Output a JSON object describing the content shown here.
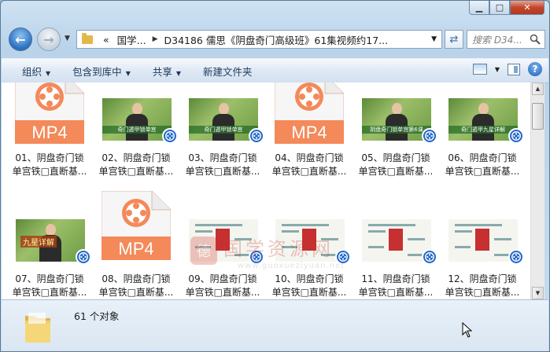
{
  "window": {
    "caption_minimize": "▁",
    "caption_maximize": "□",
    "caption_close": "✕"
  },
  "navigation": {
    "back_icon": "back-arrow-icon",
    "forward_icon": "forward-arrow-icon",
    "breadcrumb_prefix": "«",
    "breadcrumbs": [
      "国学...",
      "D34186 儒思《阴盘奇门高级班》61集视频约17..."
    ],
    "search_placeholder": "搜索 D34..."
  },
  "toolbar": {
    "organize": "组织",
    "include_in_library": "包含到库中",
    "share": "共享",
    "new_folder": "新建文件夹"
  },
  "files": [
    {
      "line1": "01、阴盘奇门锁",
      "line2": "单宫铁□直断基...",
      "kind": "mp4"
    },
    {
      "line1": "02、阴盘奇门锁",
      "line2": "单宫铁□直断基...",
      "kind": "video",
      "caption": "奇门遁甲锁单宫"
    },
    {
      "line1": "03、阴盘奇门锁",
      "line2": "单宫铁□直断基...",
      "kind": "video",
      "caption": "奇门遁甲锁单宫"
    },
    {
      "line1": "04、阴盘奇门锁",
      "line2": "单宫铁□直断基...",
      "kind": "mp4"
    },
    {
      "line1": "05、阴盘奇门锁",
      "line2": "单宫铁□直断基...",
      "kind": "video",
      "caption": "阴盘奇门锁单宫第6课"
    },
    {
      "line1": "06、阴盘奇门锁",
      "line2": "单宫铁□直断基...",
      "kind": "video",
      "caption": "奇门遁甲九星详解"
    },
    {
      "line1": "07、阴盘奇门锁",
      "line2": "单宫铁□直断基...",
      "kind": "video",
      "caption": "九星详解"
    },
    {
      "line1": "08、阴盘奇门锁",
      "line2": "单宫铁□直断基...",
      "kind": "mp4"
    },
    {
      "line1": "09、阴盘奇门锁",
      "line2": "单宫铁□直断基...",
      "kind": "slide"
    },
    {
      "line1": "10、阴盘奇门锁",
      "line2": "单宫铁□直断基...",
      "kind": "slide"
    },
    {
      "line1": "11、阴盘奇门锁",
      "line2": "单宫铁□直断基...",
      "kind": "slide"
    },
    {
      "line1": "12、阴盘奇门锁",
      "line2": "单宫铁□直断基...",
      "kind": "slide"
    }
  ],
  "mp4_label": "MP4",
  "watermark": {
    "title": "国学资源网",
    "url": "www.guoxueziyuan.net"
  },
  "status": {
    "count_text": "61 个对象"
  },
  "colors": {
    "accent": "#2268c9",
    "mp4": "#f4895a",
    "close": "#c4452b"
  }
}
